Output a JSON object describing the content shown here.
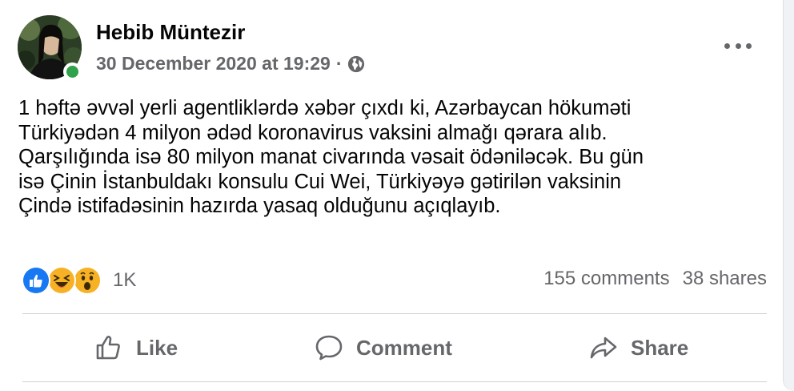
{
  "post": {
    "author": "Hebib Müntezir",
    "timestamp": "30 December 2020 at 19:29",
    "separator": "·",
    "privacy_icon": "globe-icon",
    "text_lines": [
      "1 həftə əvvəl yerli agentliklərdə xəbər çıxdı ki, Azərbaycan hökuməti",
      "Türkiyədən 4 milyon ədəd koronavirus vaksini almağı qərara alıb.",
      "Qarşılığında isə 80 milyon manat civarında vəsait ödəniləcək. Bu gün",
      "isə Çinin İstanbuldakı konsulu Cui Wei, Türkiyəyə gətirilən vaksinin",
      "Çində istifadəsinin hazırda yasaq olduğunu açıqlayıb."
    ]
  },
  "reactions": {
    "types": [
      "like",
      "haha",
      "wow"
    ],
    "count": "1K"
  },
  "stats": {
    "comments": "155 comments",
    "shares": "38 shares"
  },
  "actions": {
    "like": "Like",
    "comment": "Comment",
    "share": "Share"
  },
  "colors": {
    "text_primary": "#050505",
    "text_secondary": "#65676b",
    "online": "#31a24c",
    "like_blue": "#1877f2",
    "emoji_yellow": "#f7b125",
    "divider": "#ced0d4"
  }
}
